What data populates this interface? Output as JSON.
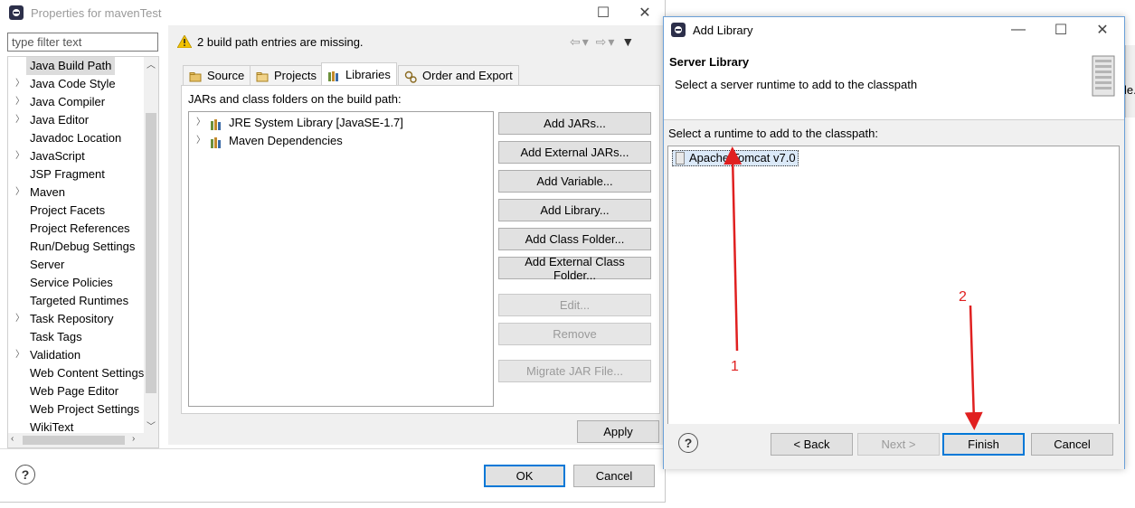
{
  "properties_window": {
    "title": "Properties for mavenTest",
    "filter_placeholder": "type filter text",
    "tree_items": [
      {
        "label": "Java Build Path",
        "has_children": false,
        "selected": true
      },
      {
        "label": "Java Code Style",
        "has_children": true
      },
      {
        "label": "Java Compiler",
        "has_children": true
      },
      {
        "label": "Java Editor",
        "has_children": true
      },
      {
        "label": "Javadoc Location",
        "has_children": false
      },
      {
        "label": "JavaScript",
        "has_children": true
      },
      {
        "label": "JSP Fragment",
        "has_children": false
      },
      {
        "label": "Maven",
        "has_children": true
      },
      {
        "label": "Project Facets",
        "has_children": false
      },
      {
        "label": "Project References",
        "has_children": false
      },
      {
        "label": "Run/Debug Settings",
        "has_children": false
      },
      {
        "label": "Server",
        "has_children": false
      },
      {
        "label": "Service Policies",
        "has_children": false
      },
      {
        "label": "Targeted Runtimes",
        "has_children": false
      },
      {
        "label": "Task Repository",
        "has_children": true
      },
      {
        "label": "Task Tags",
        "has_children": false
      },
      {
        "label": "Validation",
        "has_children": true
      },
      {
        "label": "Web Content Settings",
        "has_children": false
      },
      {
        "label": "Web Page Editor",
        "has_children": false
      },
      {
        "label": "Web Project Settings",
        "has_children": false
      },
      {
        "label": "WikiText",
        "has_children": false
      }
    ],
    "warning": "2 build path entries are missing.",
    "tabs": [
      {
        "label": "Source",
        "active": false
      },
      {
        "label": "Projects",
        "active": false
      },
      {
        "label": "Libraries",
        "active": true
      },
      {
        "label": "Order and Export",
        "active": false
      }
    ],
    "jars_label": "JARs and class folders on the build path:",
    "libraries": [
      {
        "label": "JRE System Library [JavaSE-1.7]"
      },
      {
        "label": "Maven Dependencies"
      }
    ],
    "buttons": {
      "add_jars": "Add JARs...",
      "add_external_jars": "Add External JARs...",
      "add_variable": "Add Variable...",
      "add_library": "Add Library...",
      "add_class_folder": "Add Class Folder...",
      "add_external_class_folder": "Add External Class Folder...",
      "edit": "Edit...",
      "remove": "Remove",
      "migrate_jar": "Migrate JAR File...",
      "apply": "Apply",
      "ok": "OK",
      "cancel": "Cancel"
    },
    "help": "?"
  },
  "add_library_dialog": {
    "title": "Add Library",
    "heading": "Server Library",
    "subtitle": "Select a server runtime to add to the classpath",
    "runtime_label": "Select a runtime to add to the classpath:",
    "runtimes": [
      "Apache Tomcat v7.0"
    ],
    "buttons": {
      "back": "< Back",
      "next": "Next >",
      "finish": "Finish",
      "cancel": "Cancel"
    },
    "help": "?"
  },
  "annotations": {
    "marker_1": "1",
    "marker_2": "2",
    "color": "#e02020"
  },
  "background_partial_text": "le."
}
